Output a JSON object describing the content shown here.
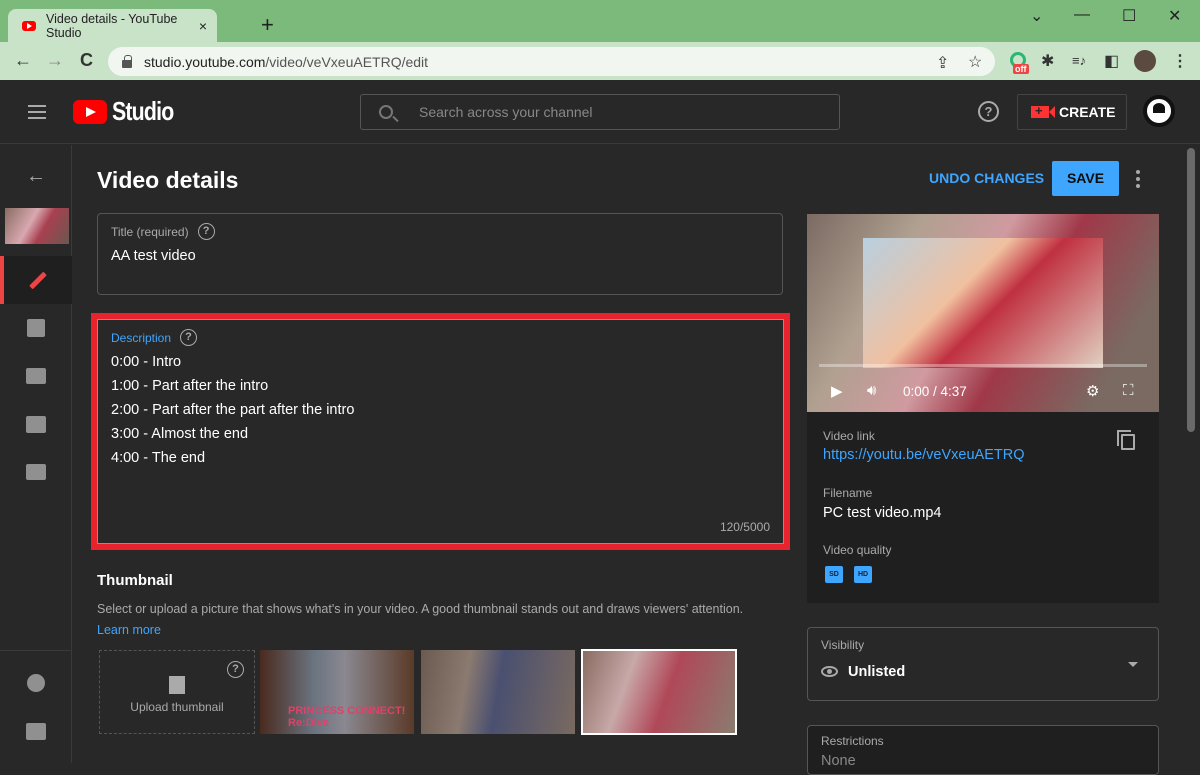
{
  "browser": {
    "tab_title": "Video details - YouTube Studio",
    "tab_close": "×",
    "new_tab": "+",
    "url_host": "studio.youtube.com",
    "url_path": "/video/veVxeuAETRQ/edit",
    "window_controls": {
      "dropdown": "⌄",
      "minimize": "—",
      "maximize": "☐",
      "close": "✕"
    },
    "nav": {
      "back": "←",
      "forward": "→",
      "reload": "C"
    },
    "toolbar_icons": {
      "share": "⇪",
      "star": "☆",
      "extension_badge": "off",
      "puzzle": "✱",
      "media": "≡♪",
      "sidepanel": "◧",
      "menu": "⋮"
    }
  },
  "header": {
    "brand": "Studio",
    "search_placeholder": "Search across your channel",
    "help": "?",
    "create_label": "CREATE"
  },
  "sidebar": {
    "back": "←",
    "items": [
      "details",
      "analytics",
      "editor",
      "comments",
      "subtitles"
    ],
    "active": "details",
    "footer": [
      "settings",
      "send-feedback"
    ]
  },
  "page": {
    "title": "Video details",
    "undo_label": "UNDO CHANGES",
    "save_label": "SAVE"
  },
  "title_field": {
    "label": "Title (required)",
    "value": "AA test video"
  },
  "description_field": {
    "label": "Description",
    "lines": [
      "0:00 - Intro",
      "1:00 - Part after the intro",
      "2:00 - Part after the part after the intro",
      "3:00 - Almost the end",
      "4:00 - The end"
    ],
    "count": "120/5000",
    "highlight_color": "#e8232c"
  },
  "thumbnail": {
    "heading": "Thumbnail",
    "description": "Select or upload a picture that shows what's in your video. A good thumbnail stands out and draws viewers' attention.",
    "learn_more": "Learn more",
    "upload_label": "Upload thumbnail",
    "thumb1_text": "PRINCESS CONNECT! Re:Dive",
    "selected_index": 3
  },
  "player": {
    "time": "0:00 / 4:37",
    "progress": 0.0
  },
  "info": {
    "video_link_label": "Video link",
    "video_link": "https://youtu.be/veVxeuAETRQ",
    "filename_label": "Filename",
    "filename": "PC test video.mp4",
    "quality_label": "Video quality",
    "qualities": [
      "SD",
      "HD"
    ]
  },
  "visibility": {
    "label": "Visibility",
    "value": "Unlisted"
  },
  "restrictions": {
    "label": "Restrictions",
    "value": "None"
  },
  "colors": {
    "accent": "#3ea6ff",
    "brand_red": "#ff0000",
    "active_red": "#ef4444"
  }
}
